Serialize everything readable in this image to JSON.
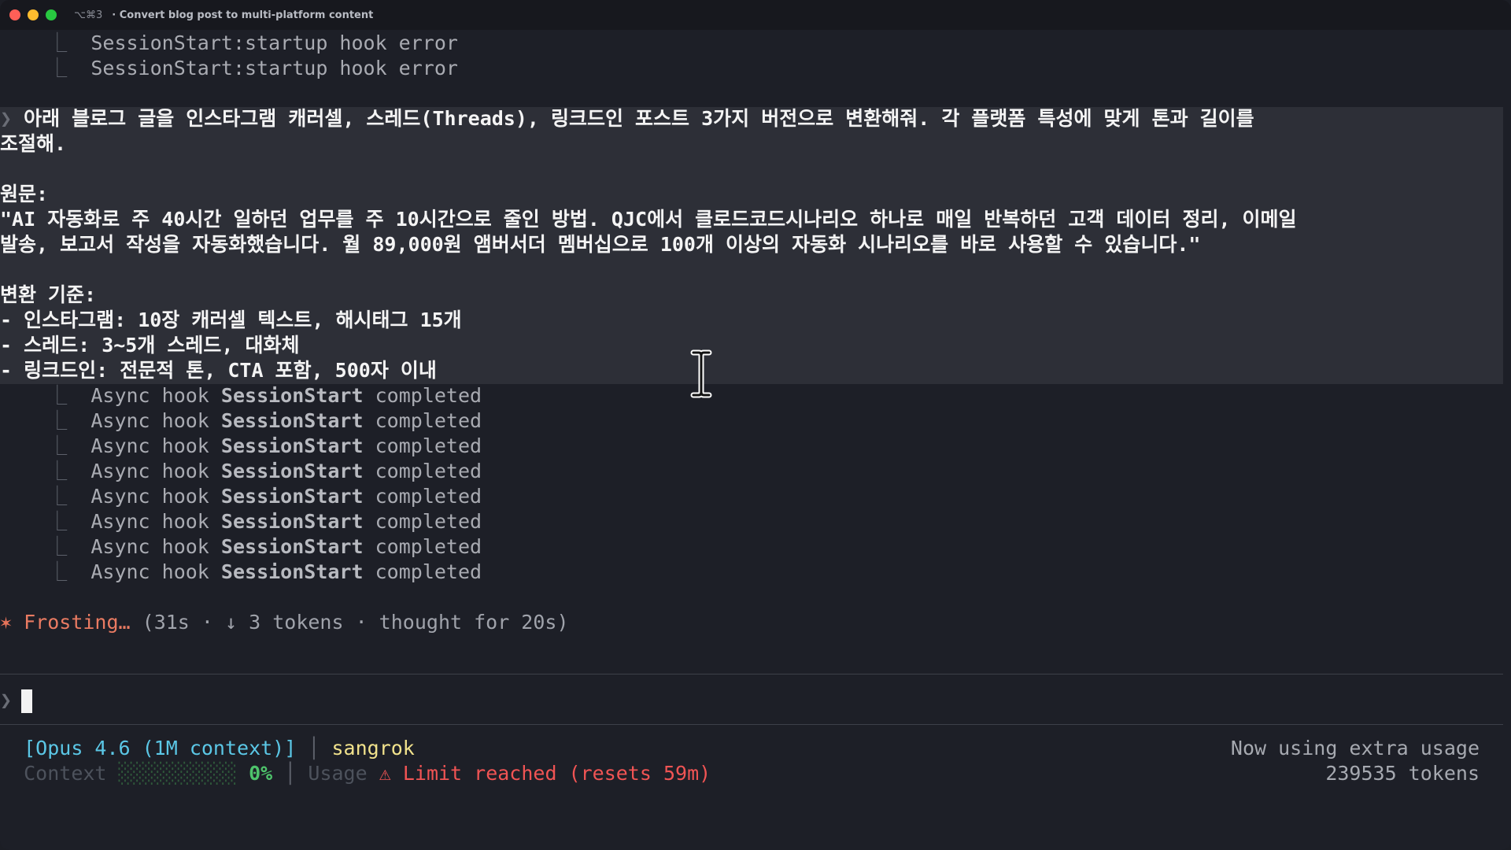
{
  "window": {
    "shortcut": "⌥⌘3",
    "title": "· Convert blog post to multi-platform content"
  },
  "hook_errors": [
    "SessionStart:startup hook error",
    "SessionStart:startup hook error"
  ],
  "prompt": {
    "lines": [
      "아래 블로그 글을 인스타그램 캐러셀, 스레드(Threads), 링크드인 포스트 3가지 버전으로 변환해줘. 각 플랫폼 특성에 맞게 톤과 길이를",
      "조절해.",
      "",
      "원문:",
      "\"AI 자동화로 주 40시간 일하던 업무를 주 10시간으로 줄인 방법. QJC에서 클로드코드시나리오 하나로 매일 반복하던 고객 데이터 정리, 이메일",
      "발송, 보고서 작성을 자동화했습니다. 월 89,000원 앰버서더 멤버십으로 100개 이상의 자동화 시나리오를 바로 사용할 수 있습니다.\"",
      "",
      "변환 기준:",
      "- 인스타그램: 10장 캐러셀 텍스트, 해시태그 15개",
      "- 스레드: 3~5개 스레드, 대화체",
      "- 링크드인: 전문적 톤, CTA 포함, 500자 이내"
    ]
  },
  "async_hooks": {
    "prefix": "Async hook",
    "hook_name": "SessionStart",
    "status": "completed",
    "count": 8
  },
  "spinner": {
    "star": "✶",
    "verb": "Frosting…",
    "meta": "(31s · ↓ 3 tokens · thought for 20s)"
  },
  "input": {
    "prompt_char": "❯",
    "value": ""
  },
  "statusline": {
    "model": "[Opus 4.6 (1M context)]",
    "user": "sangrok",
    "context_label": "Context",
    "context_bar": "░░░░░░░░░░",
    "context_percent": "0%",
    "usage_label": "Usage",
    "usage_warning": "⚠ Limit reached (resets 59m)",
    "extra_usage": "Now using extra usage",
    "tokens": "239535 tokens"
  },
  "colors": {
    "background": "#1d1f27",
    "prompt_block": "#2d2f37",
    "spinner": "#ea7b62",
    "model": "#5bc7e6",
    "user": "#f1e28c",
    "context_percent": "#4ec36b",
    "warning": "#f05454"
  }
}
